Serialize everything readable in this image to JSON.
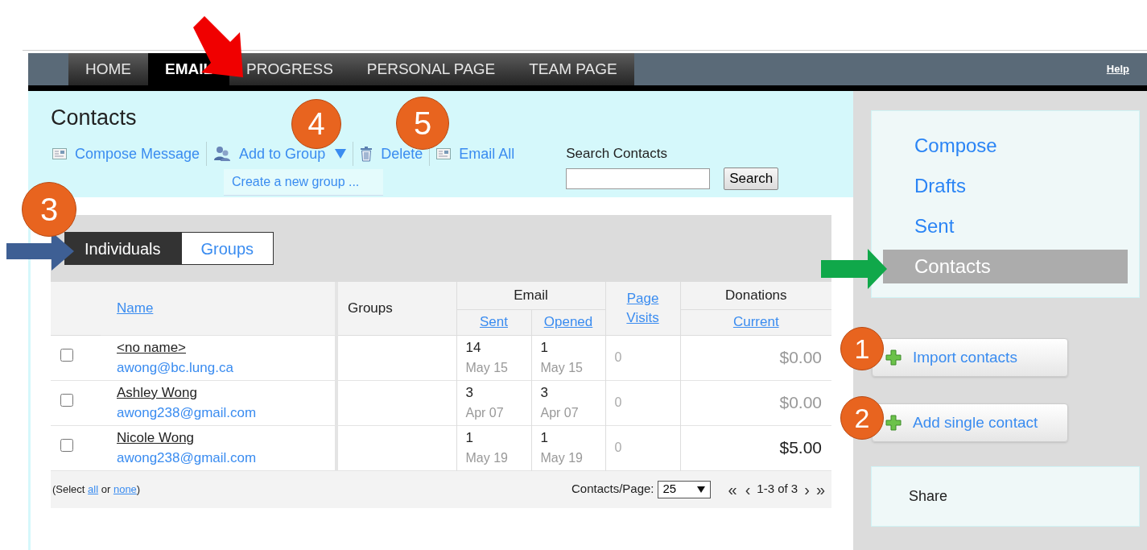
{
  "nav": {
    "items": [
      {
        "label": "HOME",
        "selected": false
      },
      {
        "label": "EMAIL",
        "selected": true
      },
      {
        "label": "PROGRESS",
        "selected": false
      },
      {
        "label": "PERSONAL PAGE",
        "selected": false
      },
      {
        "label": "TEAM PAGE",
        "selected": false
      }
    ],
    "help": "Help"
  },
  "page_title": "Contacts",
  "toolbar": [
    {
      "kind": "envelope",
      "label": "Compose Message"
    },
    {
      "kind": "group",
      "label": "Add to Group",
      "dropdown": true
    },
    {
      "kind": "trash",
      "label": "Delete"
    },
    {
      "kind": "envelope",
      "label": "Email All"
    }
  ],
  "dropdown_menu": [
    "Create a new group ..."
  ],
  "search": {
    "label": "Search Contacts",
    "button": "Search"
  },
  "view_tabs": [
    {
      "label": "Individuals",
      "selected": true
    },
    {
      "label": "Groups",
      "selected": false
    }
  ],
  "table": {
    "name": "Name",
    "groups": "Groups",
    "email": "Email",
    "sent": "Sent",
    "opened": "Opened",
    "page_visits": "Page Visits",
    "donations": "Donations",
    "current": "Current",
    "rows": [
      {
        "checked": false,
        "name": "<no name>",
        "email": "awong@bc.lung.ca",
        "sent": "14",
        "sent_date": "May 15",
        "opened": "1",
        "opened_date": "May 15",
        "visits": "0",
        "donation": "$0.00",
        "muted": true
      },
      {
        "checked": false,
        "name": "Ashley Wong",
        "email": "awong238@gmail.com",
        "sent": "3",
        "sent_date": "Apr 07",
        "opened": "3",
        "opened_date": "Apr 07",
        "visits": "0",
        "donation": "$0.00",
        "muted": true
      },
      {
        "checked": false,
        "name": "Nicole Wong",
        "email": "awong238@gmail.com",
        "sent": "1",
        "sent_date": "May 19",
        "opened": "1",
        "opened_date": "May 19",
        "visits": "0",
        "donation": "$5.00",
        "muted": false
      }
    ]
  },
  "footer": {
    "select_prefix": "(Select",
    "all": "all",
    "or": "or",
    "none": "none",
    "select_suffix": ")",
    "per_page_label": "Contacts/Page:",
    "per_page": "25",
    "first": "«",
    "prev": "‹",
    "range": "1-3 of 3",
    "next": "›",
    "last": "»"
  },
  "sidebar": {
    "items": [
      {
        "label": "Compose",
        "selected": false
      },
      {
        "label": "Drafts",
        "selected": false
      },
      {
        "label": "Sent",
        "selected": false
      },
      {
        "label": "Contacts",
        "selected": true
      }
    ],
    "buttons": [
      "Import contacts",
      "Add single contact"
    ],
    "share": "Share"
  },
  "callouts": [
    "1",
    "2",
    "3",
    "4",
    "5"
  ]
}
